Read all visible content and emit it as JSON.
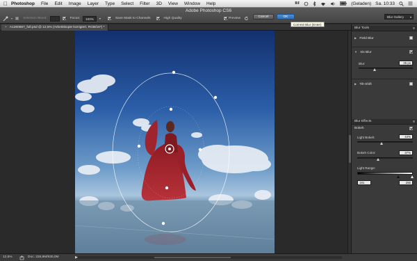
{
  "menubar": {
    "app": "Photoshop",
    "items": [
      "File",
      "Edit",
      "Image",
      "Layer",
      "Type",
      "Select",
      "Filter",
      "3D",
      "View",
      "Window",
      "Help"
    ],
    "battery": "(Geladen)",
    "clock": "Sa. 10:33"
  },
  "window": {
    "title": "Adobe Photoshop CS6"
  },
  "options": {
    "selection_bleed_label": "Selection Bleed:",
    "focus_label": "Focus:",
    "focus_value": "100%",
    "save_mask_label": "Save Mask to Channels",
    "high_quality_label": "High Quality",
    "preview_label": "Preview",
    "cancel_label": "Cancel",
    "ok_label": "OK",
    "ok_tooltip": "Commit Blur (Enter)",
    "gallery_label": "Blur Gallery"
  },
  "document": {
    "tab_close": "×",
    "tab_label": "A1260687_full.psd @ 12,5% (Arbeitskopie korrigiert, RGB/16*) *"
  },
  "blur_tools": {
    "header": "Blur Tools",
    "field_blur": "Field Blur",
    "iris_blur": "Iris Blur",
    "blur_label": "Blur:",
    "blur_value": "35 px",
    "tilt_shift": "Tilt-Shift"
  },
  "blur_effects": {
    "header": "Blur Effects",
    "bokeh": "Bokeh",
    "light_bokeh_label": "Light Bokeh:",
    "light_bokeh_value": "44%",
    "bokeh_color_label": "Bokeh Color:",
    "bokeh_color_value": "37%",
    "light_range_label": "Light Range:",
    "light_range_min": "191",
    "light_range_max": "255"
  },
  "status": {
    "zoom": "12,5%",
    "doc_size": "Doc: 228,9M/930,0M",
    "arrow": "▶"
  }
}
